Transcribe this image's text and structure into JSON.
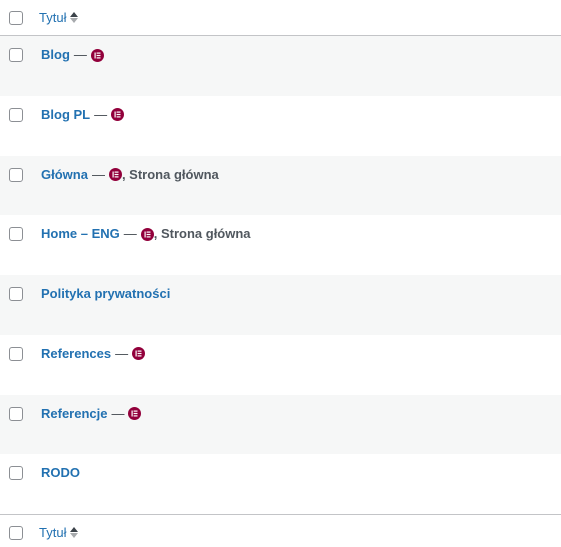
{
  "header": {
    "column_title": "Tytuł"
  },
  "footer": {
    "column_title": "Tytuł"
  },
  "colors": {
    "link": "#2271b1",
    "elementor_badge": "#92003b",
    "alt_row": "#f6f7f7"
  },
  "rows": [
    {
      "title": "Blog",
      "dash": "—",
      "elementor": true,
      "suffix": ""
    },
    {
      "title": "Blog PL",
      "dash": "—",
      "elementor": true,
      "suffix": ""
    },
    {
      "title": "Główna",
      "dash": "—",
      "elementor": true,
      "suffix": ", Strona główna"
    },
    {
      "title": "Home – ENG",
      "dash": "—",
      "elementor": true,
      "suffix": ", Strona główna"
    },
    {
      "title": "Polityka prywatności",
      "dash": "",
      "elementor": false,
      "suffix": ""
    },
    {
      "title": "References",
      "dash": "—",
      "elementor": true,
      "suffix": ""
    },
    {
      "title": "Referencje",
      "dash": "—",
      "elementor": true,
      "suffix": ""
    },
    {
      "title": "RODO",
      "dash": "",
      "elementor": false,
      "suffix": ""
    }
  ]
}
